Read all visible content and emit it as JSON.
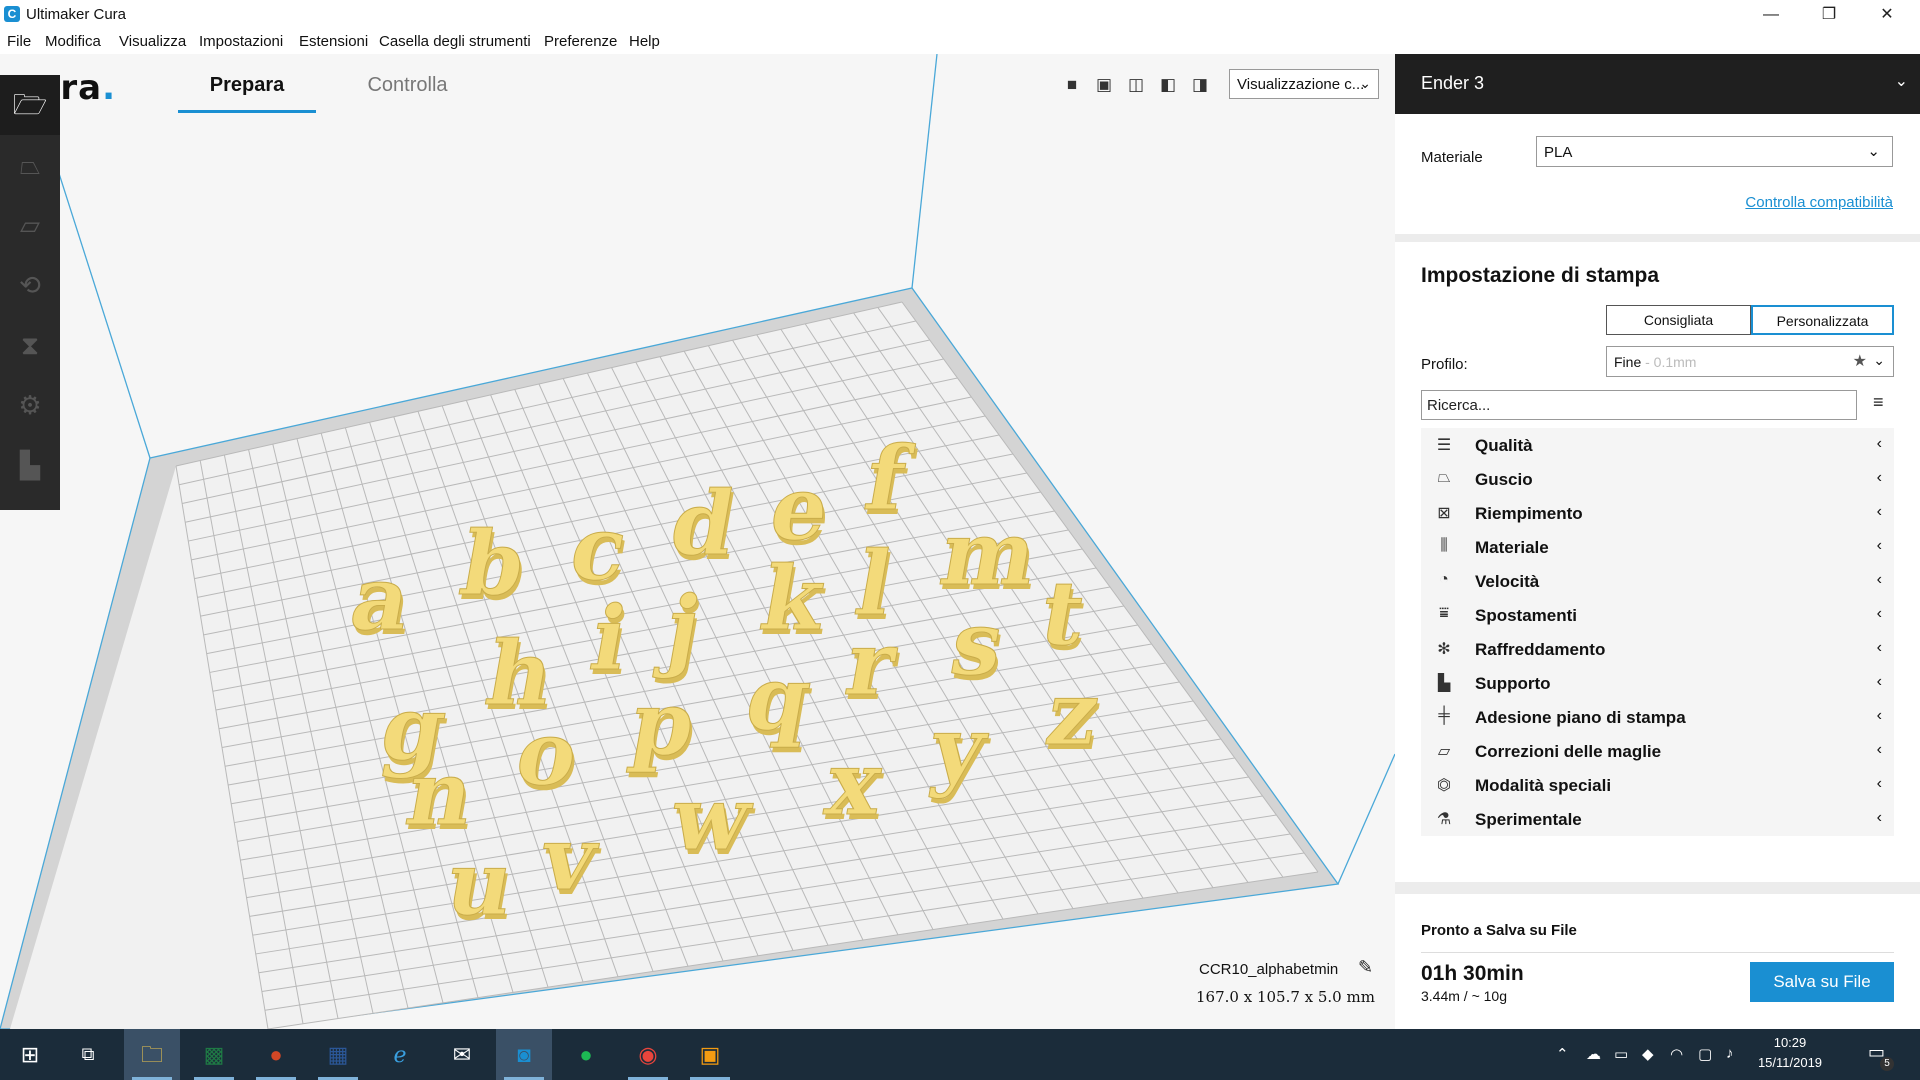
{
  "window": {
    "title": "Ultimaker Cura",
    "app_icon": "C",
    "controls": {
      "minimize": "—",
      "restore": "❐",
      "close": "✕"
    }
  },
  "menu": [
    "File",
    "Modifica",
    "Visualizza",
    "Impostazioni",
    "Estensioni",
    "Casella degli strumenti",
    "Preferenze",
    "Help"
  ],
  "header": {
    "logo": "cura",
    "tabs": {
      "prepara": "Prepara",
      "controlla": "Controlla"
    },
    "view_dropdown": "Visualizzazione c...",
    "view_icons": [
      "3d-view-icon",
      "front-view-icon",
      "top-view-icon",
      "left-view-icon",
      "right-view-icon"
    ]
  },
  "toolbar_icons": [
    "open-folder-icon",
    "move-icon",
    "scale-icon",
    "rotate-icon",
    "mirror-icon",
    "per-model-settings-icon",
    "support-blocker-icon"
  ],
  "object": {
    "name": "CCR10_alphabetmin",
    "dimensions": "167.0 x 105.7 x 5.0 mm",
    "letters": [
      "a",
      "b",
      "c",
      "d",
      "e",
      "f",
      "g",
      "h",
      "i",
      "j",
      "k",
      "l",
      "m",
      "n",
      "o",
      "p",
      "q",
      "r",
      "s",
      "t",
      "u",
      "v",
      "w",
      "x",
      "y",
      "z"
    ]
  },
  "panel": {
    "printer": "Ender 3",
    "material_label": "Materiale",
    "material_value": "PLA",
    "compat_link": "Controlla compatibilità",
    "settings_title": "Impostazione di stampa",
    "mode_recommended": "Consigliata",
    "mode_custom": "Personalizzata",
    "profile_label": "Profilo:",
    "profile_value": "Fine",
    "profile_sub": "- 0.1mm",
    "search_placeholder": "Ricerca...",
    "categories": [
      {
        "label": "Qualità",
        "icon": "quality-icon"
      },
      {
        "label": "Guscio",
        "icon": "shell-icon"
      },
      {
        "label": "Riempimento",
        "icon": "infill-icon"
      },
      {
        "label": "Materiale",
        "icon": "material-icon"
      },
      {
        "label": "Velocità",
        "icon": "speed-icon"
      },
      {
        "label": "Spostamenti",
        "icon": "travel-icon"
      },
      {
        "label": "Raffreddamento",
        "icon": "cooling-icon"
      },
      {
        "label": "Supporto",
        "icon": "support-icon"
      },
      {
        "label": "Adesione piano di stampa",
        "icon": "adhesion-icon"
      },
      {
        "label": "Correzioni delle maglie",
        "icon": "mesh-fix-icon"
      },
      {
        "label": "Modalità speciali",
        "icon": "special-modes-icon"
      },
      {
        "label": "Sperimentale",
        "icon": "experimental-icon"
      }
    ],
    "ready_label": "Pronto a Salva su File",
    "print_time": "01h 30min",
    "material_usage": "3.44m / ~ 10g",
    "save_button": "Salva su File"
  },
  "taskbar": {
    "time": "10:29",
    "date": "15/11/2019",
    "notifications": "5"
  },
  "colors": {
    "accent": "#1a8fd2",
    "letters": "#f3da7a",
    "build_plate": "#f1f1f1",
    "toolbar": "#2a2a2a",
    "taskbar": "#1b2c3a"
  }
}
